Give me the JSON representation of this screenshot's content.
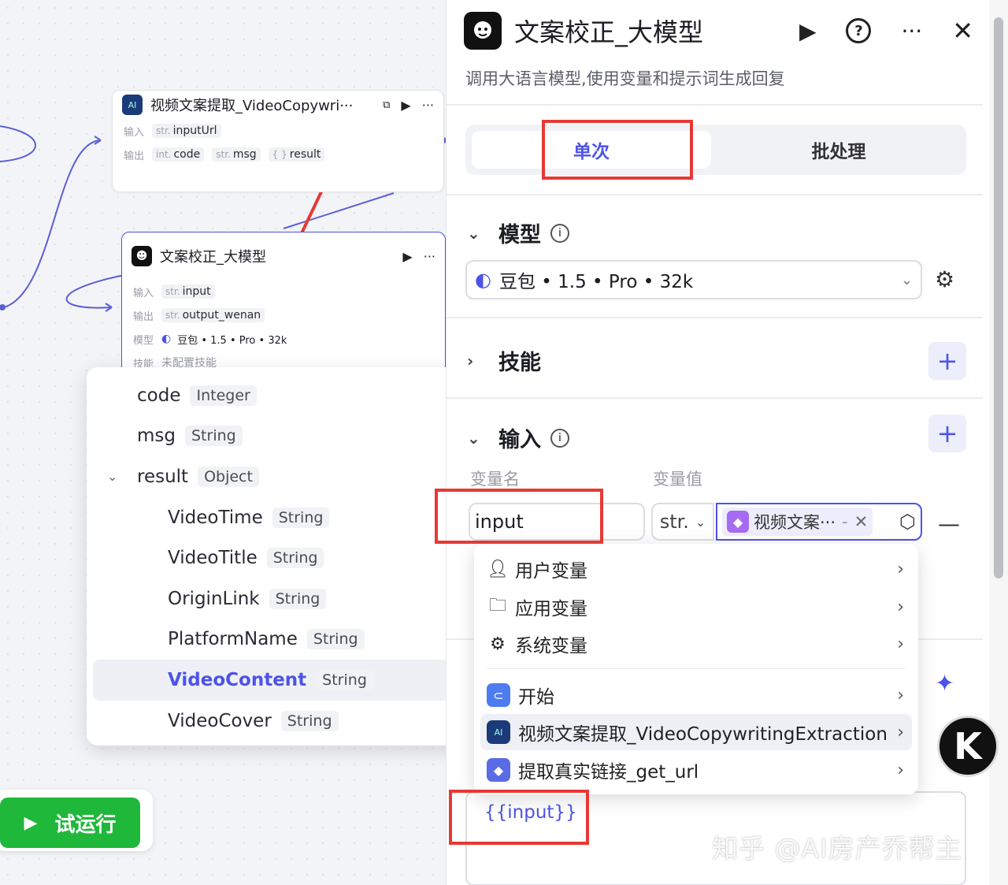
{
  "canvas": {
    "node1": {
      "title": "视频文案提取_VideoCopywri···",
      "input_label": "输入",
      "output_label": "输出",
      "inputs": [
        {
          "type": "str.",
          "name": "inputUrl"
        }
      ],
      "outputs": [
        {
          "type": "int.",
          "name": "code"
        },
        {
          "type": "str.",
          "name": "msg"
        },
        {
          "type": "{ }",
          "name": "result"
        }
      ]
    },
    "node2": {
      "title": "文案校正_大模型",
      "input_label": "输入",
      "output_label": "输出",
      "model_label": "模型",
      "skill_label": "技能",
      "input": {
        "type": "str.",
        "name": "input"
      },
      "output": {
        "type": "str.",
        "name": "output_wenan"
      },
      "model": "豆包 • 1.5 • Pro • 32k",
      "skill": "未配置技能"
    },
    "run_button": "试运行"
  },
  "var_tree": {
    "rows": [
      {
        "name": "code",
        "type": "Integer"
      },
      {
        "name": "msg",
        "type": "String"
      },
      {
        "name": "result",
        "type": "Object"
      },
      {
        "name": "VideoTime",
        "type": "String"
      },
      {
        "name": "VideoTitle",
        "type": "String"
      },
      {
        "name": "OriginLink",
        "type": "String"
      },
      {
        "name": "PlatformName",
        "type": "String"
      },
      {
        "name": "VideoContent",
        "type": "String"
      },
      {
        "name": "VideoCover",
        "type": "String"
      }
    ]
  },
  "panel": {
    "title": "文案校正_大模型",
    "description": "调用大语言模型,使用变量和提示词生成回复",
    "tabs": {
      "single": "单次",
      "batch": "批处理"
    },
    "model_section": "模型",
    "model_value": "豆包 • 1.5 • Pro • 32k",
    "skill_section": "技能",
    "input_section": "输入",
    "col_name": "变量名",
    "col_value": "变量值",
    "var_name": "input",
    "var_type": "str.",
    "var_ref": "视频文案···",
    "ref_menu": {
      "user_vars": "用户变量",
      "app_vars": "应用变量",
      "sys_vars": "系统变量",
      "start": "开始",
      "node_extract": "视频文案提取_VideoCopywritingExtraction",
      "node_geturl": "提取真实链接_get_url"
    },
    "prompt_text": "{{input}}"
  },
  "watermark": "知乎 @AI房产乔帮主",
  "colors": {
    "accent": "#4d53e8",
    "run": "#1fb83b",
    "highlight": "#e53935",
    "wire": "#5b5fd6"
  }
}
